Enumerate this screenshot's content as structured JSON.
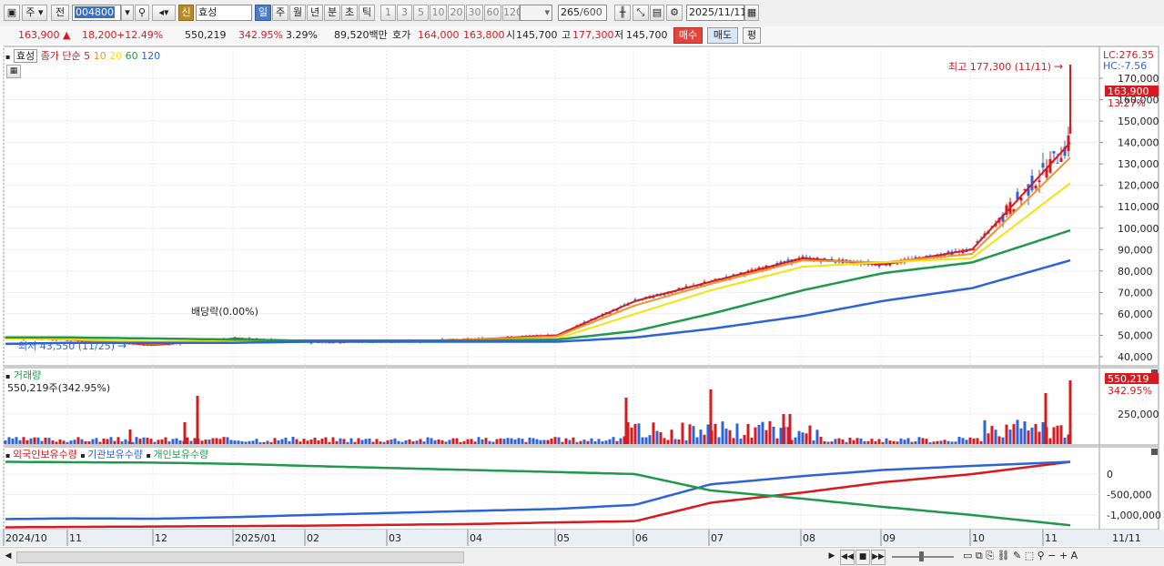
{
  "toolbar": {
    "type_label": "주",
    "prev_label": "전",
    "code": "004800",
    "new_badge": "신",
    "name": "효성",
    "periods": [
      "일",
      "주",
      "월",
      "년",
      "분",
      "초",
      "틱"
    ],
    "active_period": "일",
    "intervals": [
      "1",
      "3",
      "5",
      "10",
      "20",
      "30",
      "60",
      "120"
    ],
    "count_current": "265",
    "count_total": "/600",
    "date": "2025/11/11"
  },
  "quote": {
    "price": "163,900",
    "change": "18,200",
    "change_pct": "+12.49%",
    "volume": "550,219",
    "volume_ratio": "342.95%",
    "turnover": "3.29%",
    "amount": "89,520백만",
    "bid_label": "호가",
    "bid": "164,000",
    "ask": "163,800",
    "open_label": "시",
    "open": "145,700",
    "high_label": "고",
    "high": "177,300",
    "low_label": "저",
    "low": "145,700",
    "buy_label": "매수",
    "sell_label": "매도",
    "avg_label": "평"
  },
  "price_panel": {
    "legend_name": "효성",
    "legend_type": "종가 단순",
    "ma": [
      {
        "period": "5",
        "color": "#d71920"
      },
      {
        "period": "10",
        "color": "#f0932b"
      },
      {
        "period": "20",
        "color": "#f2e30c"
      },
      {
        "period": "60",
        "color": "#1f9a4c"
      },
      {
        "period": "120",
        "color": "#2e63d8"
      }
    ],
    "lc_label": "LC:276.35",
    "hc_label": "HC:-7.56",
    "high_annot": "최고 177,300 (11/11)",
    "low_annot": "최저 43,550 (11/25)",
    "dividend_annot": "배당락(0.00%)",
    "last_price_tag": "163,900",
    "last_pct_tag": "13.27%",
    "y_ticks": [
      "170,000",
      "160,000",
      "150,000",
      "140,000",
      "130,000",
      "120,000",
      "110,000",
      "100,000",
      "90,000",
      "80,000",
      "70,000",
      "60,000",
      "50,000",
      "40,000"
    ]
  },
  "volume_panel": {
    "title": "거래량",
    "value_label": "550,219주(342.95%)",
    "tag_value": "550,219",
    "tag_pct": "342.95%",
    "y_tick": "250,000"
  },
  "holdings_panel": {
    "legend": [
      {
        "label": "외국인보유수량",
        "color": "#d71920"
      },
      {
        "label": "기관보유수량",
        "color": "#2e63d8"
      },
      {
        "label": "개인보유수량",
        "color": "#1f9a4c"
      }
    ],
    "y_ticks": [
      "0",
      "-500,000",
      "-1,000,000"
    ]
  },
  "x_axis": {
    "labels": [
      "2024/10",
      "11",
      "12",
      "2025/01",
      "02",
      "03",
      "04",
      "05",
      "06",
      "07",
      "08",
      "09",
      "10",
      "11"
    ],
    "last_label": "11/11"
  },
  "chart_data": [
    {
      "type": "line",
      "title": "",
      "y_range": [
        40000,
        180000
      ],
      "annotations": [
        "최고 177,300 (11/11)",
        "최저 43,550 (11/25)",
        "배당락(0.00%)"
      ],
      "x": [
        "2024/10",
        "11",
        "12",
        "2025/01",
        "02",
        "03",
        "04",
        "05",
        "06",
        "07",
        "08",
        "09",
        "10",
        "11"
      ],
      "series": [
        {
          "name": "5",
          "values": [
            49000,
            48000,
            45500,
            48500,
            47000,
            47000,
            48000,
            50000,
            66000,
            75000,
            86000,
            83000,
            90000,
            140000
          ]
        },
        {
          "name": "10",
          "values": [
            48800,
            48000,
            46000,
            48000,
            47000,
            47000,
            48000,
            49500,
            64000,
            74000,
            85000,
            84000,
            88000,
            133000
          ]
        },
        {
          "name": "20",
          "values": [
            48500,
            48200,
            47000,
            47500,
            47000,
            47000,
            47500,
            48500,
            60000,
            71000,
            82000,
            84000,
            86000,
            121000
          ]
        },
        {
          "name": "60",
          "values": [
            49000,
            49000,
            48500,
            48000,
            47500,
            47500,
            47500,
            48000,
            52000,
            60000,
            71000,
            79000,
            84000,
            99000
          ]
        },
        {
          "name": "120",
          "values": [
            46000,
            46500,
            46500,
            46500,
            47000,
            47000,
            47000,
            47000,
            49000,
            53000,
            59000,
            66000,
            72000,
            85000
          ]
        }
      ]
    },
    {
      "type": "line",
      "title": "",
      "y_range": [
        -1300000,
        400000
      ],
      "x": [
        "2024/10",
        "11",
        "12",
        "2025/01",
        "02",
        "03",
        "04",
        "05",
        "06",
        "07",
        "08",
        "09",
        "10",
        "11"
      ],
      "series": [
        {
          "name": "외국인보유수량",
          "values": [
            -1300000,
            -1290000,
            -1280000,
            -1270000,
            -1260000,
            -1240000,
            -1220000,
            -1180000,
            -1150000,
            -700000,
            -450000,
            -200000,
            0,
            300000
          ]
        },
        {
          "name": "기관보유수량",
          "values": [
            -1100000,
            -1080000,
            -1090000,
            -1050000,
            -1000000,
            -950000,
            -900000,
            -850000,
            -750000,
            -250000,
            -50000,
            100000,
            200000,
            300000
          ]
        },
        {
          "name": "개인보유수량",
          "values": [
            300000,
            290000,
            280000,
            250000,
            200000,
            150000,
            100000,
            50000,
            0,
            -400000,
            -600000,
            -800000,
            -1000000,
            -1250000
          ]
        }
      ]
    }
  ]
}
